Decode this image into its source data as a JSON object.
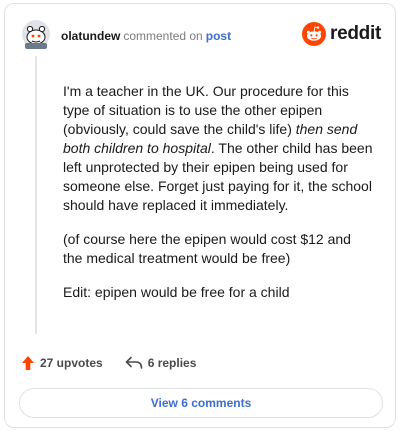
{
  "header": {
    "username": "olatundew",
    "action": "commented on",
    "post_link": "post",
    "brand": "reddit"
  },
  "comment": {
    "p1_before": "I'm a teacher in the UK. Our procedure for this type of situation is to use the other epipen (obviously, could save the child's life) ",
    "p1_emphasis": "then send both children to hospital",
    "p1_after": ". The other child has been left unprotected by their epipen being used for someone else. Forget just paying for it, the school should have replaced it immediately.",
    "p2": "(of course here the epipen would cost $12 and the medical treatment would be free)",
    "p3": "Edit: epipen would be free for a child"
  },
  "footer": {
    "upvotes": "27 upvotes",
    "replies": "6 replies",
    "view_comments": "View 6 comments"
  },
  "colors": {
    "brand_orange": "#ff4500",
    "link_blue": "#3b6fd1",
    "upvote_icon": "#ff4500"
  }
}
